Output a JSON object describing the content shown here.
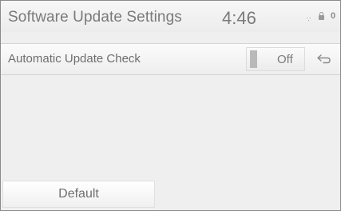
{
  "header": {
    "title": "Software Update Settings",
    "time": "4:46",
    "status_icons": {
      "signal": "∵",
      "lock": "lock-icon",
      "count": "0"
    }
  },
  "settings": {
    "rows": [
      {
        "label": "Automatic Update Check",
        "value": "Off"
      }
    ]
  },
  "back_icon": "back-arrow-icon",
  "footer": {
    "default_label": "Default"
  }
}
